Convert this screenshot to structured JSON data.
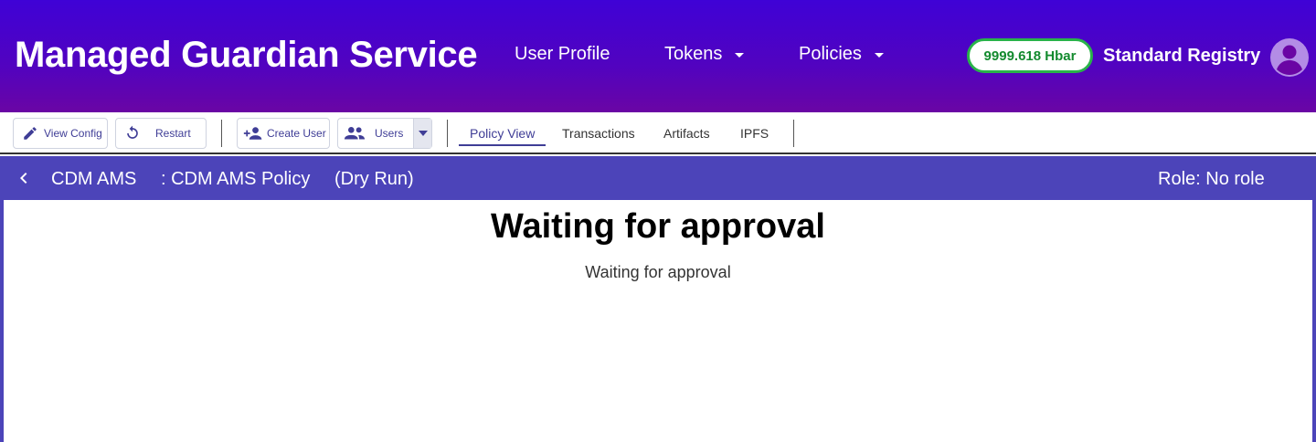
{
  "header": {
    "title": "Managed Guardian Service",
    "nav": {
      "user_profile": "User Profile",
      "tokens": "Tokens",
      "policies": "Policies"
    },
    "balance": "9999.618 Hbar",
    "account_role": "Standard Registry",
    "avatar_icon": "account-circle-icon"
  },
  "toolbar": {
    "view_config": "View Config",
    "restart": "Restart",
    "create_user": "Create User",
    "users": "Users",
    "tabs": [
      "Policy View",
      "Transactions",
      "Artifacts",
      "IPFS"
    ],
    "active_tab": "Policy View"
  },
  "policy_bar": {
    "policy_name": "CDM AMS",
    "policy_subtitle": ": CDM AMS Policy",
    "mode": "(Dry Run)",
    "role": "Role: No role"
  },
  "main": {
    "heading": "Waiting for approval",
    "message": "Waiting for approval"
  },
  "colors": {
    "header_gradient_start": "#3f02d6",
    "header_gradient_end": "#6a05a4",
    "policy_bar": "#4c44b9",
    "balance_border": "#29b34a",
    "balance_text": "#138a2e",
    "accent": "#3f3d96"
  }
}
